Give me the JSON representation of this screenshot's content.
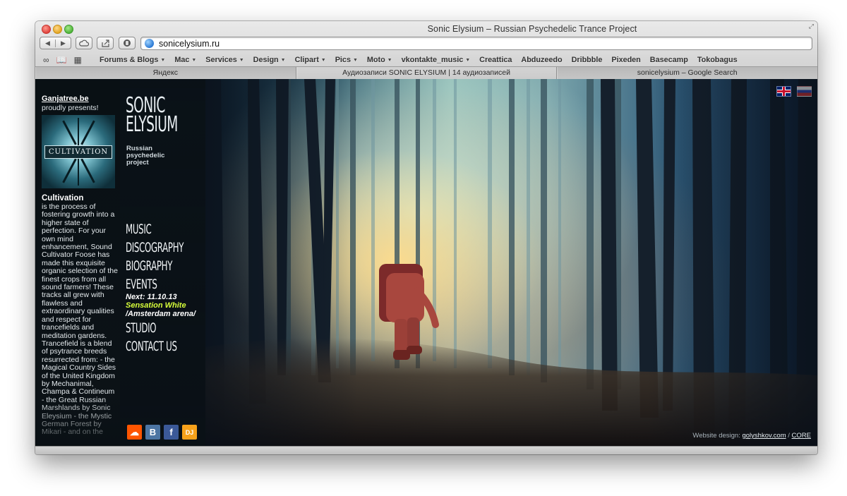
{
  "window": {
    "title": "Sonic Elysium – Russian Psychedelic Trance Project",
    "url": "sonicelysium.ru"
  },
  "toolbar": {
    "back_icon": "back-arrow-icon",
    "forward_icon": "forward-arrow-icon",
    "cloud_icon": "icloud-tabs-icon",
    "share_icon": "share-icon",
    "reader_icon": "reader-icon"
  },
  "bookmarks": [
    {
      "label": "Forums & Blogs",
      "menu": true
    },
    {
      "label": "Mac",
      "menu": true
    },
    {
      "label": "Services",
      "menu": true
    },
    {
      "label": "Design",
      "menu": true
    },
    {
      "label": "Clipart",
      "menu": true
    },
    {
      "label": "Pics",
      "menu": true
    },
    {
      "label": "Moto",
      "menu": true
    },
    {
      "label": "vkontakte_music",
      "menu": true
    },
    {
      "label": "Creattica",
      "menu": false
    },
    {
      "label": "Abduzeedo",
      "menu": false
    },
    {
      "label": "Dribbble",
      "menu": false
    },
    {
      "label": "Pixeden",
      "menu": false
    },
    {
      "label": "Basecamp",
      "menu": false
    },
    {
      "label": "Tokobagus",
      "menu": false
    }
  ],
  "tabs": [
    {
      "label": "Яндекс"
    },
    {
      "label": "Аудиозаписи SONIC ELYSIUM | 14 аудиозаписей"
    },
    {
      "label": "sonicelysium – Google Search"
    }
  ],
  "promo": {
    "link": "Ganjatree.be",
    "sub": "proudly presents!",
    "album_title": "CULTIVATION",
    "heading": "Cultivation",
    "body": "is the process of fostering growth into a higher state of perfection. For your own mind enhancement, Sound Cultivator Foose has made this exquisite organic selection of the finest crops from all sound farmers! These tracks all grew with flawless and extraordinary qualities and respect for trancefields and meditation gardens. Trancefield is a blend of psytrance breeds resurrected from: - the Magical Country Sides of the United Kingdom by Mechanimal, Champa & Contineum - the Great Russian Marshlands by Sonic Eleysium - the Mystic German Forest by Mikari - and on the"
  },
  "site": {
    "logo_line1": "SONIC",
    "logo_line2": "ELYSIUM",
    "tagline_1": "Russian",
    "tagline_2": "psychedelic",
    "tagline_3": "project",
    "menu": {
      "music": "MUSIC",
      "discography": "DISCOGRAPHY",
      "biography": "BIOGRAPHY",
      "events": "EVENTS",
      "studio": "STUDIO",
      "contact": "CONTACT US"
    },
    "event": {
      "next": "Next: 11.10.13",
      "name": "Sensation White",
      "location": "/Amsterdam arena/"
    },
    "social": [
      {
        "name": "soundcloud-icon",
        "glyph": "☁",
        "color": "#ff5500"
      },
      {
        "name": "vkontakte-icon",
        "glyph": "B",
        "color": "#4c75a3"
      },
      {
        "name": "facebook-icon",
        "glyph": "f",
        "color": "#3b5998"
      },
      {
        "name": "promodj-icon",
        "glyph": "DJ",
        "color": "#f7a21b"
      }
    ],
    "flags": {
      "en": "uk-flag-icon",
      "ru": "ru-flag-icon"
    },
    "credits": {
      "label": "Website design:",
      "designer": "golyshkov.com",
      "sep": "/",
      "core": "CORE"
    }
  },
  "colors": {
    "event_highlight": "#d8ff3a",
    "page_dark": "#0a0f14"
  }
}
